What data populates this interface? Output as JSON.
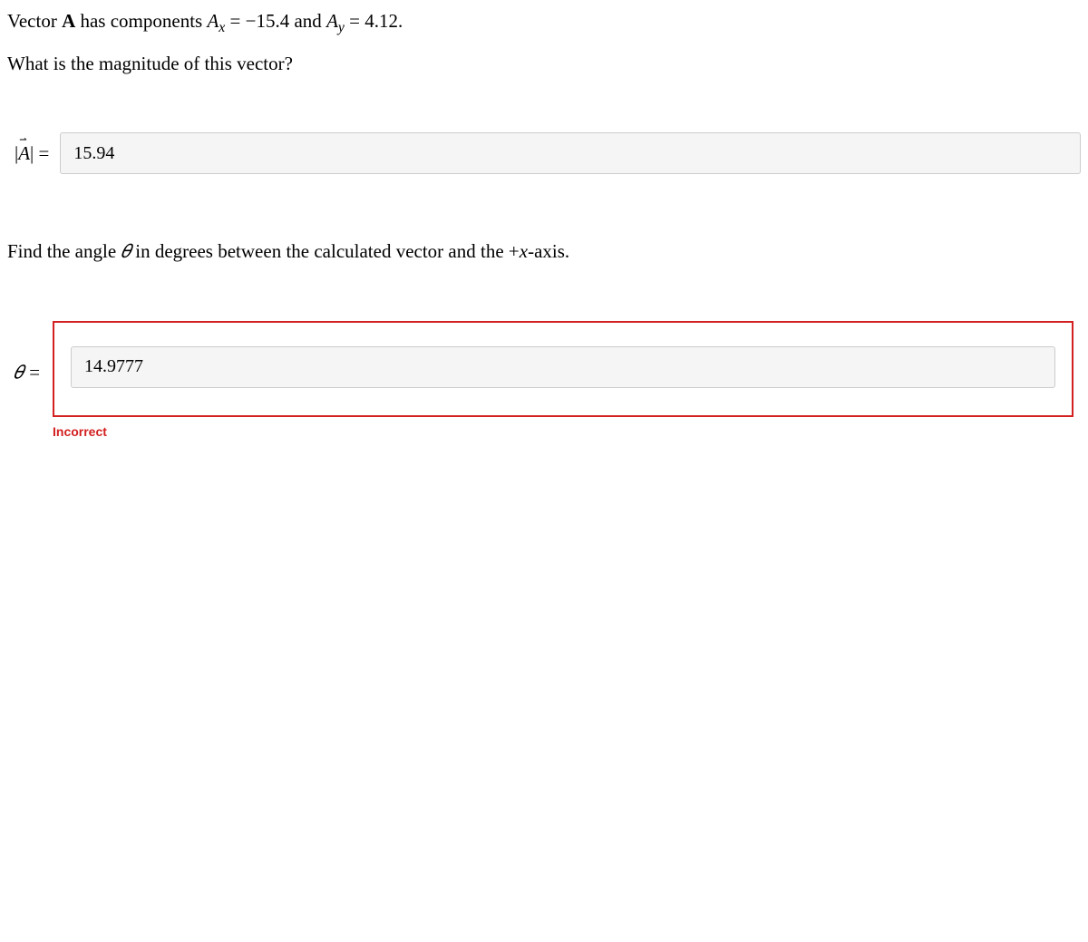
{
  "problem": {
    "line1_pre": "Vector ",
    "line1_vec": "A",
    "line1_mid1": " has components ",
    "line1_Ax": "A",
    "line1_Ax_sub": "x",
    "line1_eq1": " = −15.4 and ",
    "line1_Ay": "A",
    "line1_Ay_sub": "y",
    "line1_eq2": " = 4.12.",
    "line2": "What is the magnitude of this vector?"
  },
  "answer1": {
    "label_open": "|",
    "label_vec": "A",
    "label_close": "| =",
    "value": "15.94"
  },
  "question2": {
    "pre": "Find the angle ",
    "theta": "𝜃",
    "mid": " in degrees between the calculated vector and the +",
    "x": "x",
    "post": "-axis."
  },
  "answer2": {
    "label": "𝜃 =",
    "value": "14.9777",
    "feedback": "Incorrect"
  }
}
